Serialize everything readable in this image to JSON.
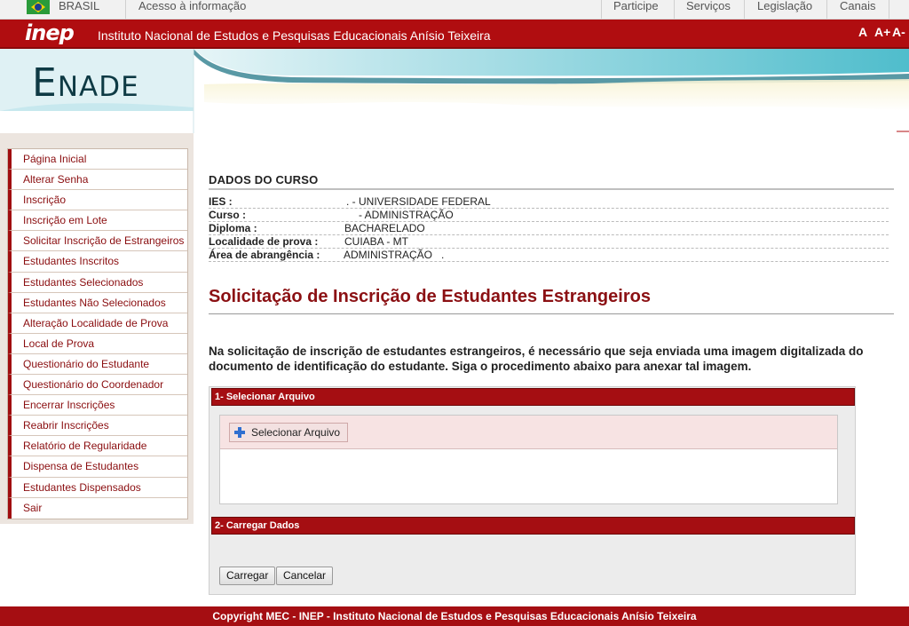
{
  "gov_bar": {
    "country": "BRASIL",
    "access_info": "Acesso à informação",
    "nav": [
      "Participe",
      "Serviços",
      "Legislação",
      "Canais"
    ]
  },
  "header": {
    "logo": "inep",
    "institute": "Instituto Nacional de Estudos e Pesquisas Educacionais Anísio Teixeira",
    "font_controls": [
      "A",
      "A+",
      "A-"
    ]
  },
  "banner": {
    "logo_initial": "E",
    "logo_rest": "NADE"
  },
  "sidebar": {
    "items": [
      "Página Inicial",
      "Alterar Senha",
      "Inscrição",
      "Inscrição em Lote",
      "Solicitar Inscrição de Estrangeiros",
      "Estudantes Inscritos",
      "Estudantes Selecionados",
      "Estudantes Não Selecionados",
      "Alteração Localidade de Prova",
      "Local de Prova",
      "Questionário do Estudante",
      "Questionário do Coordenador",
      "Encerrar Inscrições",
      "Reabrir Inscrições",
      "Relatório de Regularidade",
      "Dispensa de Estudantes",
      "Estudantes Dispensados",
      "Sair"
    ]
  },
  "course": {
    "section_title": "DADOS DO CURSO",
    "rows": [
      {
        "label": "IES :",
        "value": ". - UNIVERSIDADE FEDERAL"
      },
      {
        "label": "Curso :",
        "value": "- ADMINISTRAÇÃO"
      },
      {
        "label": "Diploma :",
        "value": "BACHARELADO"
      },
      {
        "label": "Localidade de prova :",
        "value": "CUIABA - MT"
      },
      {
        "label": "Área de abrangência :",
        "value": "ADMINISTRAÇÃO   ."
      }
    ]
  },
  "main": {
    "heading": "Solicitação de Inscrição de Estudantes Estrangeiros",
    "intro": "Na solicitação de inscrição de estudantes estrangeiros, é necessário que seja enviada uma imagem digitalizada do documento de identificação do estudante. Siga o procedimento abaixo para anexar tal imagem.",
    "step1_title": "1- Selecionar Arquivo",
    "select_file_label": "Selecionar Arquivo",
    "step2_title": "2- Carregar Dados",
    "load_label": "Carregar",
    "cancel_label": "Cancelar"
  },
  "footer": {
    "text": "Copyright MEC - INEP - Instituto Nacional de Estudos e Pesquisas Educacionais Anísio Teixeira"
  },
  "colors": {
    "brand_red": "#b00d10",
    "heading_red": "#8b1013",
    "banner_teal": "#3fb5c4"
  }
}
